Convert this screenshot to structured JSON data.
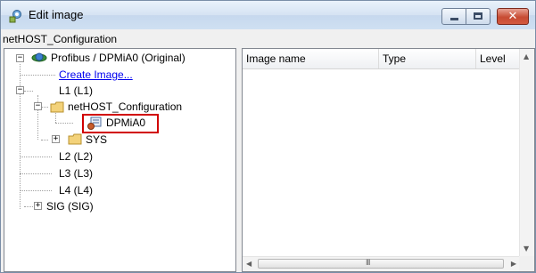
{
  "window": {
    "title": "Edit image",
    "icon": "edit-image-icon",
    "caption_buttons": [
      "minimize-icon",
      "maximize-icon",
      "close-icon"
    ],
    "close_glyph": "✕"
  },
  "config_label": "netHOST_Configuration",
  "tree": {
    "root": {
      "label": "Profibus / DPMiA0 (Original)",
      "expander": "⊟",
      "icon": "network-globe-icon"
    },
    "create_link": "Create Image...",
    "l1": {
      "label": "L1 (L1)",
      "expander": "⊟"
    },
    "config_node": {
      "label": "netHOST_Configuration",
      "expander": "⊟",
      "icon": "folder-icon"
    },
    "selected_node": {
      "label": "DPMiA0",
      "icon": "device-image-icon"
    },
    "sys": {
      "label": "SYS",
      "expander": "⊞",
      "icon": "folder-icon"
    },
    "l2": "L2 (L2)",
    "l3": "L3 (L3)",
    "l4": "L4 (L4)",
    "sig": {
      "label": "SIG (SIG)",
      "expander": "⊞"
    },
    "highlight_color": "#d10000"
  },
  "list": {
    "columns": [
      "Image name",
      "Type",
      "Level"
    ],
    "rows": [],
    "hscroll_grip": "III"
  }
}
